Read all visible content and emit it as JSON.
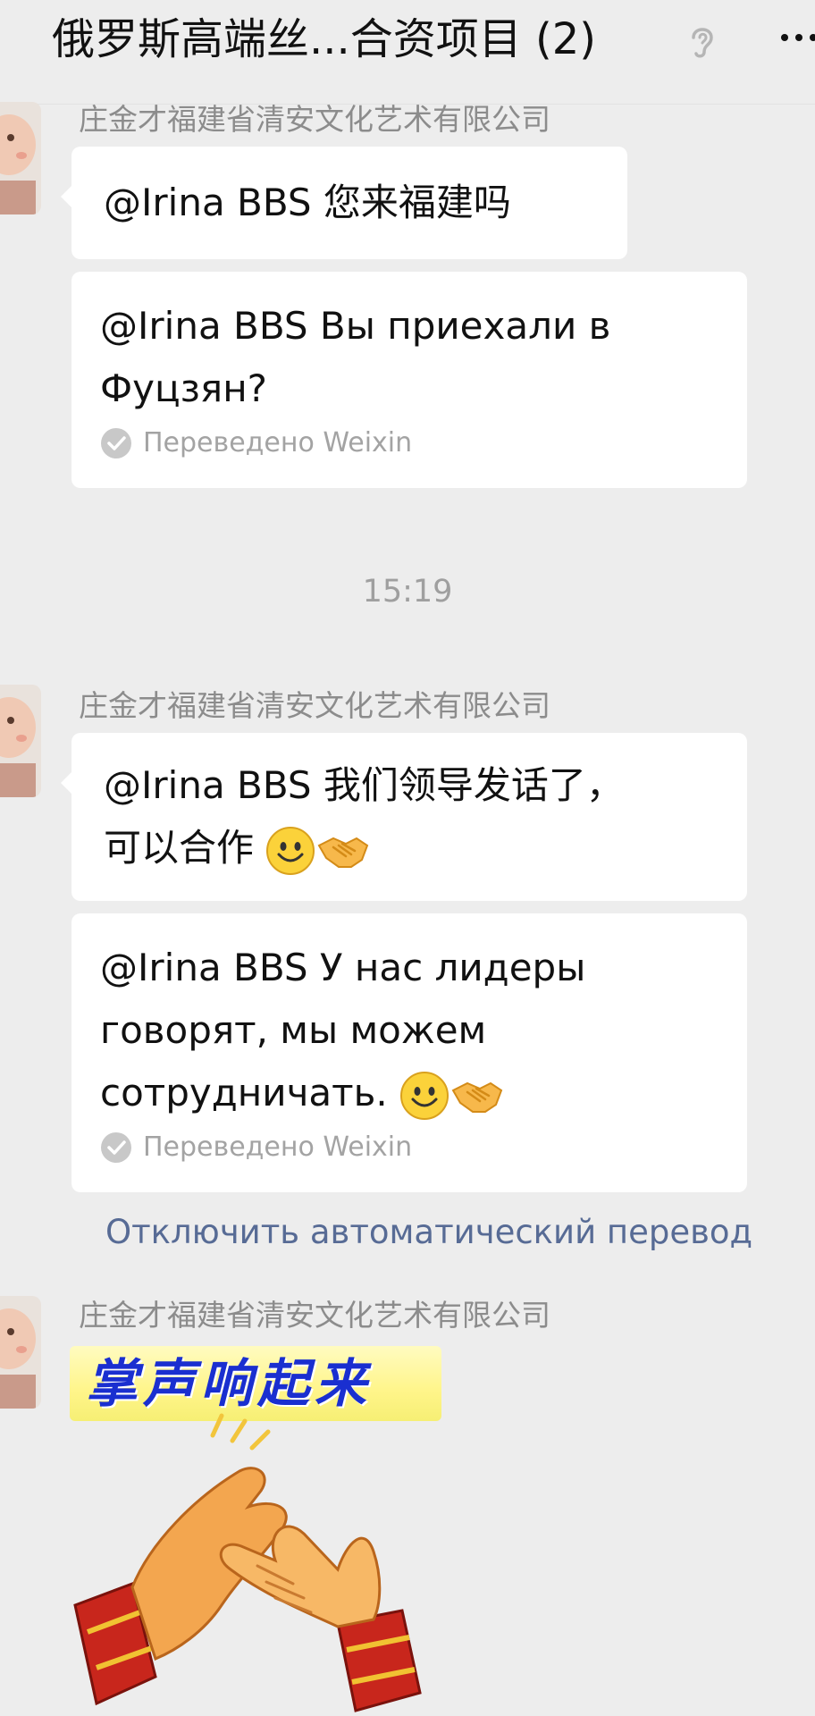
{
  "header": {
    "title": "俄罗斯高端丝...合资项目 (2)",
    "ear_icon": "ear-icon",
    "more_icon": "more-icon"
  },
  "messages": [
    {
      "sender": "庄金才福建省清安文化艺术有限公司",
      "text": "@Irina BBS  您来福建吗",
      "translation": "@Irina BBS Вы приехали в\nФуцзян?",
      "translation_label": "Переведено Weixin"
    },
    {
      "sender": "庄金才福建省清安文化艺术有限公司",
      "text": "@Irina BBS  我们领导发话了，\n可以合作",
      "emoji": [
        "smile-emoji",
        "handshake-emoji"
      ],
      "translation": "@Irina BBS У нас лидеры\nговорят, мы можем\nсотрудничать. ",
      "translation_label": "Переведено Weixin"
    },
    {
      "sender": "庄金才福建省清安文化艺术有限公司",
      "sticker_text": "掌声响起来",
      "sticker_icon": "clapping-hands-sticker"
    }
  ],
  "timestamp": "15:19",
  "disable_translation_link": "Отключить автоматический перевод",
  "colors": {
    "background": "#ededed",
    "bubble": "#ffffff",
    "link": "#576b95",
    "meta_text": "#8c8c8c"
  }
}
